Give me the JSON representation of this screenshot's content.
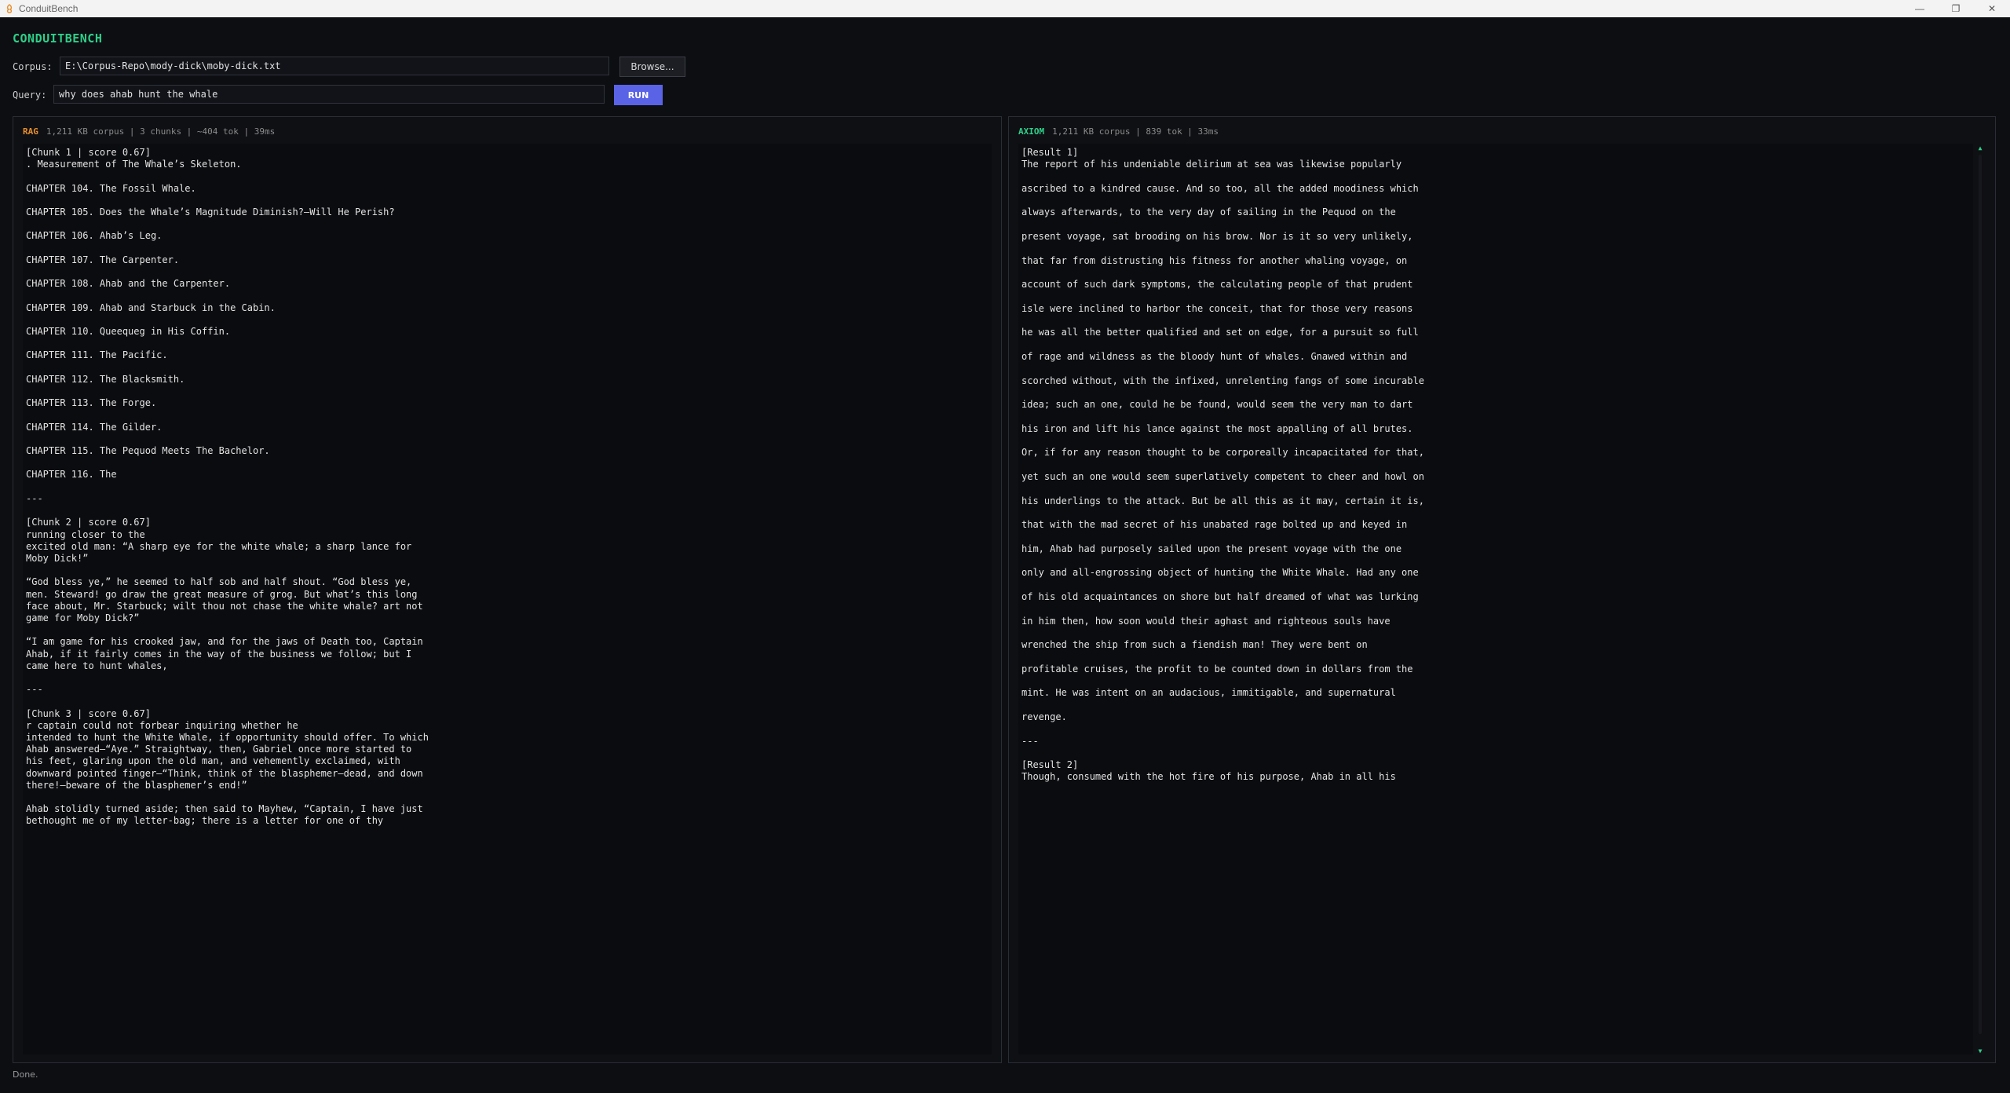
{
  "window": {
    "title": "ConduitBench",
    "minimize_glyph": "—",
    "restore_glyph": "❐",
    "close_glyph": "✕"
  },
  "app": {
    "brand": "CONDUITBENCH"
  },
  "corpus": {
    "label": "Corpus:",
    "value": "E:\\Corpus-Repo\\mody-dick\\moby-dick.txt",
    "browse_label": "Browse..."
  },
  "query": {
    "label": "Query:",
    "value": "why does ahab hunt the whale",
    "run_label": "RUN"
  },
  "rag": {
    "tag": "RAG",
    "stats": "1,211 KB corpus | 3 chunks | ~404 tok | 39ms",
    "text": "[Chunk 1 | score 0.67]\n. Measurement of The Whale’s Skeleton.\n\nCHAPTER 104. The Fossil Whale.\n\nCHAPTER 105. Does the Whale’s Magnitude Diminish?—Will He Perish?\n\nCHAPTER 106. Ahab’s Leg.\n\nCHAPTER 107. The Carpenter.\n\nCHAPTER 108. Ahab and the Carpenter.\n\nCHAPTER 109. Ahab and Starbuck in the Cabin.\n\nCHAPTER 110. Queequeg in His Coffin.\n\nCHAPTER 111. The Pacific.\n\nCHAPTER 112. The Blacksmith.\n\nCHAPTER 113. The Forge.\n\nCHAPTER 114. The Gilder.\n\nCHAPTER 115. The Pequod Meets The Bachelor.\n\nCHAPTER 116. The\n\n---\n\n[Chunk 2 | score 0.67]\nrunning closer to the\nexcited old man: “A sharp eye for the white whale; a sharp lance for\nMoby Dick!”\n\n“God bless ye,” he seemed to half sob and half shout. “God bless ye,\nmen. Steward! go draw the great measure of grog. But what’s this long\nface about, Mr. Starbuck; wilt thou not chase the white whale? art not\ngame for Moby Dick?”\n\n“I am game for his crooked jaw, and for the jaws of Death too, Captain\nAhab, if it fairly comes in the way of the business we follow; but I\ncame here to hunt whales,\n\n---\n\n[Chunk 3 | score 0.67]\nr captain could not forbear inquiring whether he\nintended to hunt the White Whale, if opportunity should offer. To which\nAhab answered—“Aye.” Straightway, then, Gabriel once more started to\nhis feet, glaring upon the old man, and vehemently exclaimed, with\ndownward pointed finger—“Think, think of the blasphemer—dead, and down\nthere!—beware of the blasphemer’s end!”\n\nAhab stolidly turned aside; then said to Mayhew, “Captain, I have just\nbethought me of my letter-bag; there is a letter for one of thy"
  },
  "axiom": {
    "tag": "AXIOM",
    "stats": "1,211 KB corpus | 839 tok | 33ms",
    "text": "[Result 1]\nThe report of his undeniable delirium at sea was likewise popularly\n\nascribed to a kindred cause. And so too, all the added moodiness which\n\nalways afterwards, to the very day of sailing in the Pequod on the\n\npresent voyage, sat brooding on his brow. Nor is it so very unlikely,\n\nthat far from distrusting his fitness for another whaling voyage, on\n\naccount of such dark symptoms, the calculating people of that prudent\n\nisle were inclined to harbor the conceit, that for those very reasons\n\nhe was all the better qualified and set on edge, for a pursuit so full\n\nof rage and wildness as the bloody hunt of whales. Gnawed within and\n\nscorched without, with the infixed, unrelenting fangs of some incurable\n\nidea; such an one, could he be found, would seem the very man to dart\n\nhis iron and lift his lance against the most appalling of all brutes.\n\nOr, if for any reason thought to be corporeally incapacitated for that,\n\nyet such an one would seem superlatively competent to cheer and howl on\n\nhis underlings to the attack. But be all this as it may, certain it is,\n\nthat with the mad secret of his unabated rage bolted up and keyed in\n\nhim, Ahab had purposely sailed upon the present voyage with the one\n\nonly and all-engrossing object of hunting the White Whale. Had any one\n\nof his old acquaintances on shore but half dreamed of what was lurking\n\nin him then, how soon would their aghast and righteous souls have\n\nwrenched the ship from such a fiendish man! They were bent on\n\nprofitable cruises, the profit to be counted down in dollars from the\n\nmint. He was intent on an audacious, immitigable, and supernatural\n\nrevenge.\n\n---\n\n[Result 2]\nThough, consumed with the hot fire of his purpose, Ahab in all his"
  },
  "status": "Done.",
  "colors": {
    "brand": "#2ed08a",
    "rag_tag": "#e8902c",
    "axiom_tag": "#2ed08a",
    "run_button": "#5a63e6"
  }
}
